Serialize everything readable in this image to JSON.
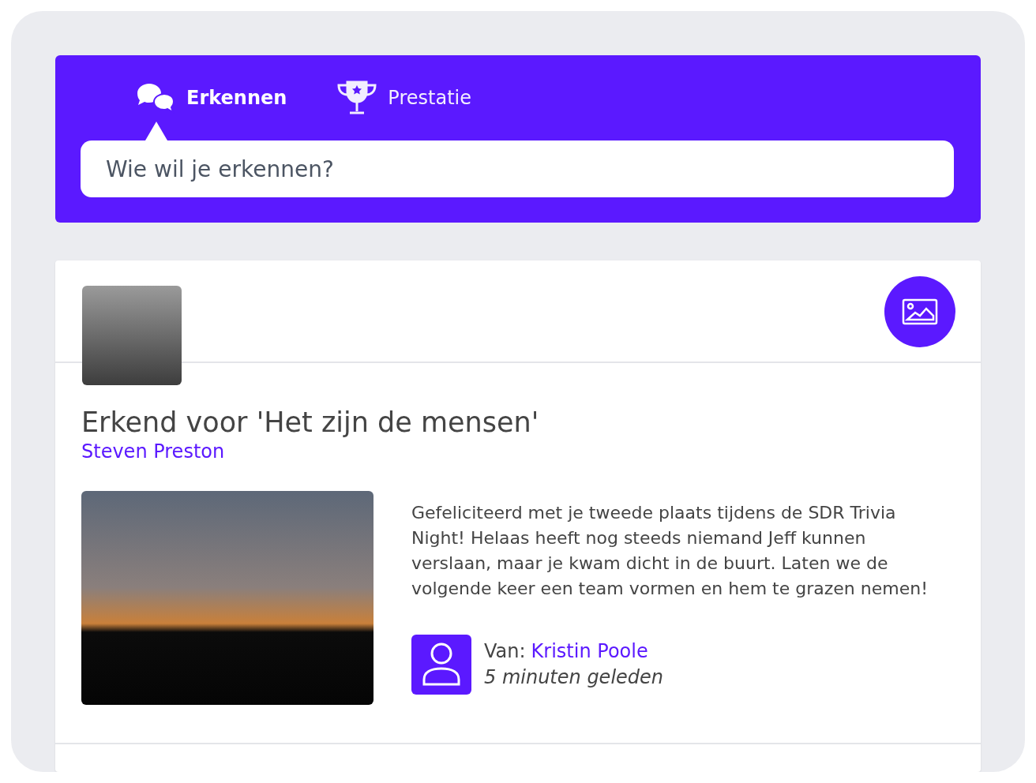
{
  "tabs": [
    {
      "label": "Erkennen",
      "kind": "chat",
      "selected": true
    },
    {
      "label": "Prestatie",
      "kind": "trophy",
      "selected": false
    }
  ],
  "search": {
    "placeholder": "Wie wil je erkennen?"
  },
  "post": {
    "title": "Erkend voor 'Het zijn de mensen'",
    "recipient": "Steven Preston",
    "message": "Gefeliciteerd met je tweede plaats tijdens de SDR Trivia Night! Helaas heeft nog steeds niemand Jeff kunnen verslaan, maar je kwam dicht in de buurt. Laten we de volgende keer een team vormen en hem te grazen nemen!",
    "from_label": "Van:",
    "from_name": "Kristin Poole",
    "time": "5 minuten geleden"
  }
}
